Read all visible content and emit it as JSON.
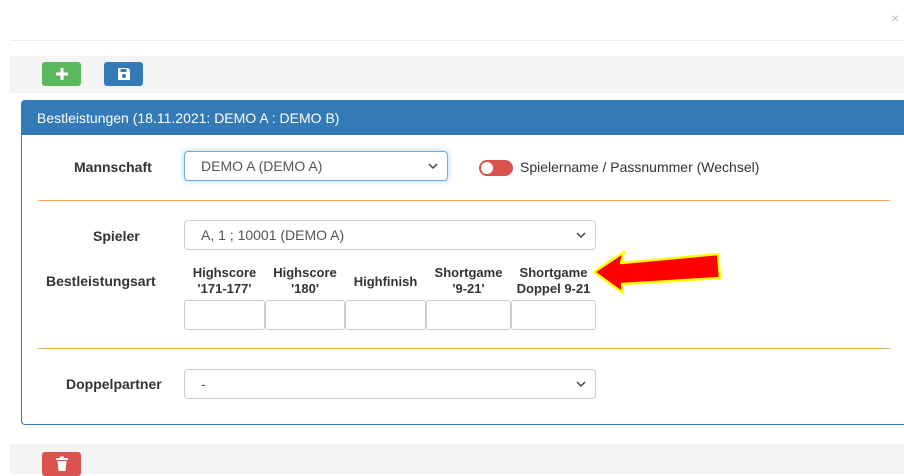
{
  "dialog": {
    "close_glyph": "×"
  },
  "toolbar": {
    "add_icon": "plus-icon",
    "save_icon": "floppy-disk-icon",
    "add_color": "#5cb85c",
    "save_color": "#337ab7"
  },
  "panel": {
    "title": "Bestleistungen (18.11.2021: DEMO A : DEMO B)",
    "header_color": "#337ab7"
  },
  "form": {
    "mannschaft_label": "Mannschaft",
    "mannschaft_value": "DEMO A (DEMO A)",
    "toggle_label": "Spielername / Passnummer (Wechsel)",
    "toggle_color": "#d9534f",
    "spieler_label": "Spieler",
    "spieler_value": "A, 1 ; 10001 (DEMO A)",
    "bestleistungsart_label": "Bestleistungsart",
    "columns": [
      {
        "line1": "Highscore",
        "line2": "'171-177'"
      },
      {
        "line1": "Highscore",
        "line2": "'180'"
      },
      {
        "line1": "Highfinish",
        "line2": ""
      },
      {
        "line1": "Shortgame",
        "line2": "'9-21'"
      },
      {
        "line1": "Shortgame",
        "line2": "Doppel 9-21"
      }
    ],
    "doppelpartner_label": "Doppelpartner",
    "doppelpartner_value": "-"
  },
  "annotation": {
    "arrow_color": "#ff0000",
    "arrow_outline": "#ffff00"
  },
  "bottom": {
    "delete_icon": "trash-icon",
    "delete_color": "#d9534f"
  }
}
